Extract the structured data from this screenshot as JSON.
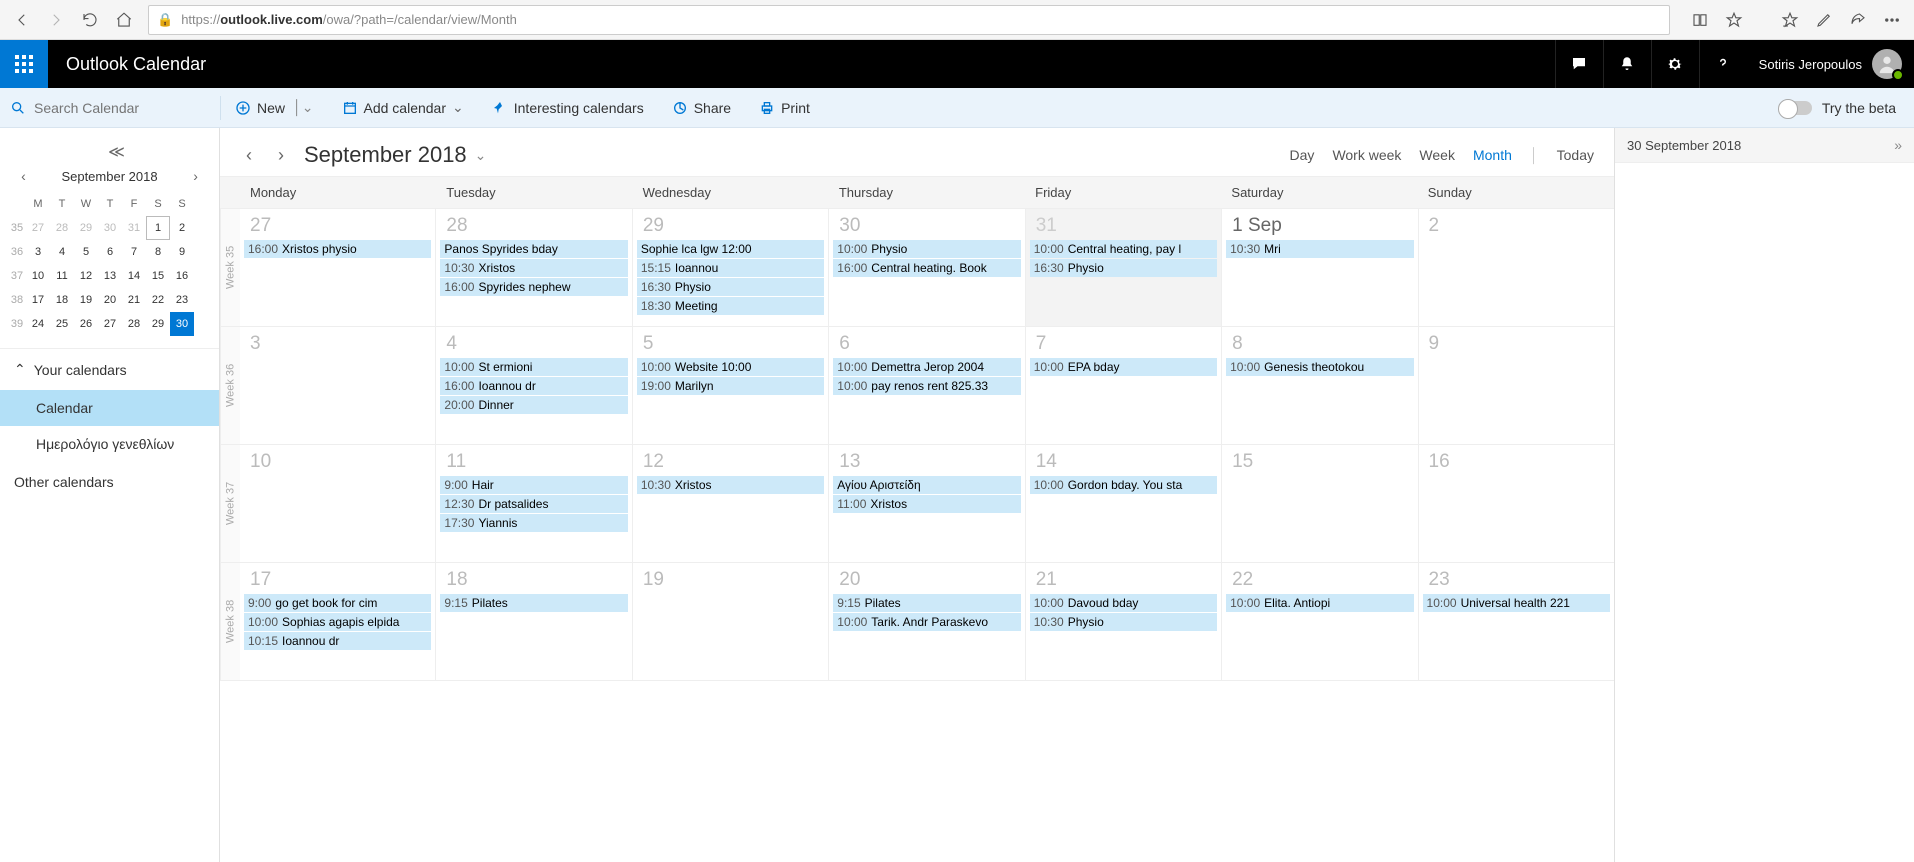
{
  "browser": {
    "url_prefix": "https://",
    "url_host": "outlook.live.com",
    "url_path": "/owa/?path=/calendar/view/Month"
  },
  "header": {
    "app_title": "Outlook Calendar",
    "user_name": "Sotiris Jeropoulos"
  },
  "cmdbar": {
    "search_placeholder": "Search Calendar",
    "new": "New",
    "add_calendar": "Add calendar",
    "interesting": "Interesting calendars",
    "share": "Share",
    "print": "Print",
    "try_beta": "Try the beta"
  },
  "mini": {
    "month_label": "September 2018",
    "dow": [
      "M",
      "T",
      "W",
      "T",
      "F",
      "S",
      "S"
    ],
    "weeknums": [
      "35",
      "36",
      "37",
      "38",
      "39"
    ],
    "rows": [
      [
        {
          "n": "27",
          "dim": true
        },
        {
          "n": "28",
          "dim": true
        },
        {
          "n": "29",
          "dim": true
        },
        {
          "n": "30",
          "dim": true
        },
        {
          "n": "31",
          "dim": true
        },
        {
          "n": "1",
          "box": true
        },
        {
          "n": "2"
        }
      ],
      [
        {
          "n": "3"
        },
        {
          "n": "4"
        },
        {
          "n": "5"
        },
        {
          "n": "6"
        },
        {
          "n": "7"
        },
        {
          "n": "8"
        },
        {
          "n": "9"
        }
      ],
      [
        {
          "n": "10"
        },
        {
          "n": "11"
        },
        {
          "n": "12"
        },
        {
          "n": "13"
        },
        {
          "n": "14"
        },
        {
          "n": "15"
        },
        {
          "n": "16"
        }
      ],
      [
        {
          "n": "17"
        },
        {
          "n": "18"
        },
        {
          "n": "19"
        },
        {
          "n": "20"
        },
        {
          "n": "21"
        },
        {
          "n": "22"
        },
        {
          "n": "23"
        }
      ],
      [
        {
          "n": "24"
        },
        {
          "n": "25"
        },
        {
          "n": "26"
        },
        {
          "n": "27"
        },
        {
          "n": "28"
        },
        {
          "n": "29"
        },
        {
          "n": "30",
          "sel": true
        }
      ]
    ]
  },
  "sidebar": {
    "your_calendars": "Your calendars",
    "calendar_item": "Calendar",
    "birthday_cal": "Ημερολόγιο γενεθλίων",
    "other_calendars": "Other calendars"
  },
  "cal": {
    "title": "September 2018",
    "views": {
      "day": "Day",
      "workweek": "Work week",
      "week": "Week",
      "month": "Month",
      "today": "Today"
    },
    "dows": [
      "Monday",
      "Tuesday",
      "Wednesday",
      "Thursday",
      "Friday",
      "Saturday",
      "Sunday"
    ],
    "weeks": [
      {
        "label": "Week 35",
        "days": [
          {
            "num": "27",
            "dim": true,
            "events": [
              {
                "t": "16:00",
                "s": "Xristos physio"
              }
            ]
          },
          {
            "num": "28",
            "dim": true,
            "events": [
              {
                "t": "",
                "s": "Panos Spyrides bday"
              },
              {
                "t": "10:30",
                "s": "Xristos"
              },
              {
                "t": "16:00",
                "s": "Spyrides nephew"
              }
            ]
          },
          {
            "num": "29",
            "dim": true,
            "events": [
              {
                "t": "",
                "s": "Sophie lca lgw 12:00"
              },
              {
                "t": "15:15",
                "s": "Ioannou"
              },
              {
                "t": "16:30",
                "s": "Physio"
              },
              {
                "t": "18:30",
                "s": "Meeting"
              }
            ]
          },
          {
            "num": "30",
            "dim": true,
            "events": [
              {
                "t": "10:00",
                "s": "Physio"
              },
              {
                "t": "16:00",
                "s": "Central heating. Book"
              }
            ]
          },
          {
            "num": "31",
            "dim": true,
            "shade": true,
            "events": [
              {
                "t": "10:00",
                "s": "Central heating, pay l"
              },
              {
                "t": "16:30",
                "s": "Physio"
              }
            ]
          },
          {
            "num": "1 Sep",
            "strong": true,
            "events": [
              {
                "t": "10:30",
                "s": "Mri"
              }
            ]
          },
          {
            "num": "2",
            "events": []
          }
        ]
      },
      {
        "label": "Week 36",
        "days": [
          {
            "num": "3",
            "events": []
          },
          {
            "num": "4",
            "events": [
              {
                "t": "10:00",
                "s": "St ermioni"
              },
              {
                "t": "16:00",
                "s": "Ioannou dr"
              },
              {
                "t": "20:00",
                "s": "Dinner"
              }
            ]
          },
          {
            "num": "5",
            "events": [
              {
                "t": "10:00",
                "s": "Website 10:00"
              },
              {
                "t": "19:00",
                "s": "Marilyn"
              }
            ]
          },
          {
            "num": "6",
            "events": [
              {
                "t": "10:00",
                "s": "Demettra Jerop 2004"
              },
              {
                "t": "10:00",
                "s": "pay renos rent 825.33"
              }
            ]
          },
          {
            "num": "7",
            "events": [
              {
                "t": "10:00",
                "s": "EPA bday"
              }
            ]
          },
          {
            "num": "8",
            "events": [
              {
                "t": "10:00",
                "s": "Genesis theotokou"
              }
            ]
          },
          {
            "num": "9",
            "events": []
          }
        ]
      },
      {
        "label": "Week 37",
        "days": [
          {
            "num": "10",
            "events": []
          },
          {
            "num": "11",
            "events": [
              {
                "t": "9:00",
                "s": "Hair"
              },
              {
                "t": "12:30",
                "s": "Dr patsalides"
              },
              {
                "t": "17:30",
                "s": "Yiannis"
              }
            ]
          },
          {
            "num": "12",
            "events": [
              {
                "t": "10:30",
                "s": "Xristos"
              }
            ]
          },
          {
            "num": "13",
            "events": [
              {
                "t": "",
                "s": "Αγίου Αριστείδη"
              },
              {
                "t": "11:00",
                "s": "Xristos"
              }
            ]
          },
          {
            "num": "14",
            "events": [
              {
                "t": "10:00",
                "s": "Gordon bday. You sta"
              }
            ]
          },
          {
            "num": "15",
            "events": []
          },
          {
            "num": "16",
            "events": []
          }
        ]
      },
      {
        "label": "Week 38",
        "days": [
          {
            "num": "17",
            "events": [
              {
                "t": "9:00",
                "s": "go get book for cim"
              },
              {
                "t": "10:00",
                "s": "Sophias agapis elpida"
              },
              {
                "t": "10:15",
                "s": "Ioannou dr"
              }
            ]
          },
          {
            "num": "18",
            "events": [
              {
                "t": "9:15",
                "s": "Pilates"
              }
            ]
          },
          {
            "num": "19",
            "events": []
          },
          {
            "num": "20",
            "events": [
              {
                "t": "9:15",
                "s": "Pilates"
              },
              {
                "t": "10:00",
                "s": "Tarik. Andr Paraskevo"
              }
            ]
          },
          {
            "num": "21",
            "events": [
              {
                "t": "10:00",
                "s": "Davoud bday"
              },
              {
                "t": "10:30",
                "s": "Physio"
              }
            ]
          },
          {
            "num": "22",
            "events": [
              {
                "t": "10:00",
                "s": "Elita. Antiopi"
              }
            ]
          },
          {
            "num": "23",
            "events": [
              {
                "t": "10:00",
                "s": "Universal health 221"
              }
            ]
          }
        ]
      }
    ]
  },
  "detail": {
    "date": "30 September 2018"
  }
}
